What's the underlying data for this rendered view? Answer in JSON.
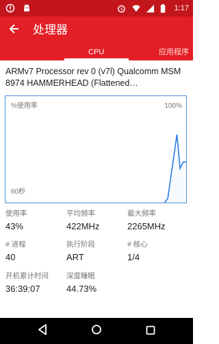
{
  "status_bar": {
    "time": "1:17",
    "left_icons": [
      "notification-icon",
      "android-icon"
    ],
    "right_icons": [
      "alarm-icon",
      "wifi-icon",
      "signal-icon",
      "battery-icon"
    ]
  },
  "app_bar": {
    "title": "处理器",
    "back_icon": "arrow-back-icon"
  },
  "tabs": [
    {
      "label": "CPU",
      "selected": true
    },
    {
      "label": "应用程序",
      "selected": false
    }
  ],
  "processor_name": "ARMv7 Processor rev 0 (v7l) Qualcomm MSM 8974 HAMMERHEAD (Flattened…",
  "graph": {
    "top_left_label": "%使用率",
    "top_right_label": "100%",
    "bottom_left_label": "60秒",
    "line_color": "#2a7ae2",
    "points_percent": [
      0,
      0,
      0,
      0,
      0,
      0,
      0,
      0,
      0,
      0,
      0,
      0,
      0,
      0,
      0,
      0,
      0,
      0,
      0,
      0,
      0,
      0,
      0,
      0,
      0,
      0,
      0,
      0,
      0,
      0,
      0,
      0,
      0,
      0,
      0,
      0,
      0,
      0,
      0,
      0,
      0,
      0,
      0,
      0,
      0,
      0,
      0,
      0,
      0,
      0,
      0,
      0,
      0,
      4,
      24,
      44,
      64,
      32,
      38,
      38
    ]
  },
  "stats": [
    {
      "label": "使用率",
      "value": "43%"
    },
    {
      "label": "平均频率",
      "value": "422MHz"
    },
    {
      "label": "最大频率",
      "value": "2265MHz"
    },
    {
      "label": "# 进程",
      "value": "40"
    },
    {
      "label": "执行阶段",
      "value": "ART"
    },
    {
      "label": "# 核心",
      "value": "1/4"
    },
    {
      "label": "开机累计时间",
      "value": "36:39:07"
    },
    {
      "label": "深度睡眠",
      "value": "44.73%"
    }
  ],
  "nav_bar": {
    "icons": [
      "back-triangle-icon",
      "home-circle-icon",
      "recents-square-icon"
    ]
  }
}
